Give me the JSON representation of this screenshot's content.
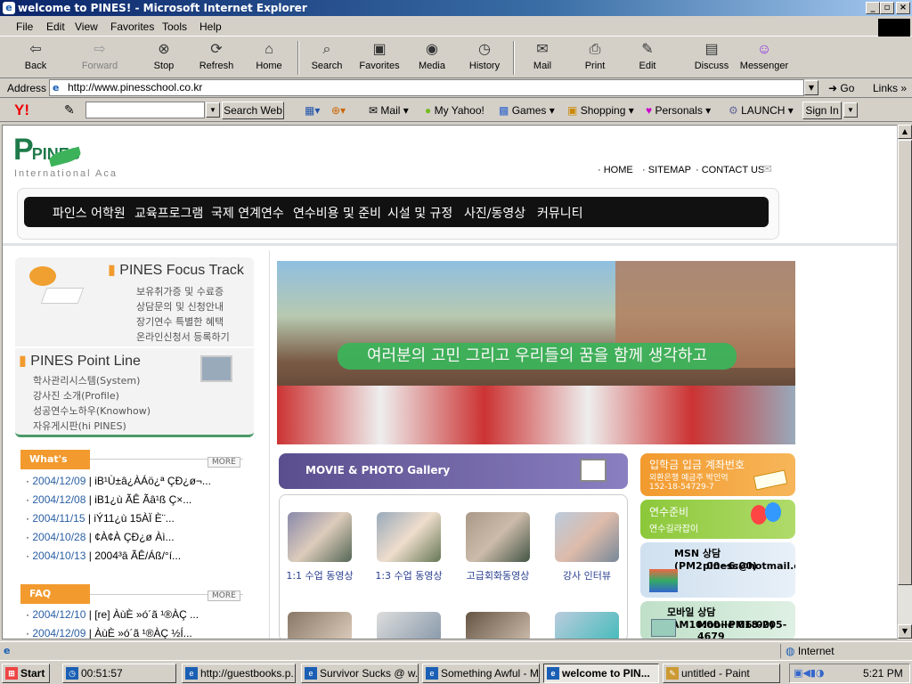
{
  "window": {
    "title": "welcome to PINES! - Microsoft Internet Explorer",
    "minimize": "_",
    "maximize": "▫",
    "close": "×"
  },
  "menu": [
    "File",
    "Edit",
    "View",
    "Favorites",
    "Tools",
    "Help"
  ],
  "toolbar": {
    "back": "Back",
    "forward": "Forward",
    "stop": "Stop",
    "refresh": "Refresh",
    "home": "Home",
    "search": "Search",
    "favorites": "Favorites",
    "media": "Media",
    "history": "History",
    "mail": "Mail",
    "print": "Print",
    "edit": "Edit",
    "discuss": "Discuss",
    "messenger": "Messenger"
  },
  "address": {
    "label": "Address",
    "url": "http://www.pinesschool.co.kr",
    "go": "Go",
    "links": "Links"
  },
  "yahoo": {
    "search_btn": "Search Web",
    "mail": "Mail",
    "myyahoo": "My Yahoo!",
    "games": "Games",
    "shopping": "Shopping",
    "personals": "Personals",
    "launch": "LAUNCH",
    "signin": "Sign In"
  },
  "page": {
    "logo_text": "PINES",
    "logo_sub": "International Aca",
    "top_links": [
      "HOME",
      "SITEMAP",
      "CONTACT US"
    ],
    "main_nav": [
      "파인스 어학원",
      "교육프로그램",
      "국제 연계연수",
      "연수비용 및 준비",
      "시설 및 규정",
      "사진/동영상",
      "커뮤니티"
    ],
    "focus_title": "PINES Focus Track",
    "focus_items": [
      "보유취가증 및 수료증",
      "상담문의 및 신청안내",
      "장기연수 특별한 혜택",
      "온라인신청서 등록하기"
    ],
    "point_title": "PINES Point Line",
    "point_items": [
      "학사관리시스템(System)",
      "강사진 소개(Profile)",
      "성공연수노하우(Knowhow)",
      "자유게시판(hi PINES)"
    ],
    "news_label": "What's News",
    "more": "MORE",
    "news": [
      {
        "date": "2004/12/09",
        "text": "iB¹Ù±â¿ÀÁö¿ª ÇÐ¿ø¬..."
      },
      {
        "date": "2004/12/08",
        "text": "iB1¿ù ÃÊ Ãâ¹ß Ç×..."
      },
      {
        "date": "2004/11/15",
        "text": "iÝ11¿ù 15ÀÏ È¨..."
      },
      {
        "date": "2004/10/28",
        "text": "¢À¢À ÇÐ¿ø Àì..."
      },
      {
        "date": "2004/10/13",
        "text": "2004³â ÃÊ/Áß/°í..."
      }
    ],
    "faq_label": "FAQ",
    "faq": [
      {
        "date": "2004/12/10",
        "text": "[re] ÀùÈ »ó´ã ¹®ÀÇ ..."
      },
      {
        "date": "2004/12/09",
        "text": "ÀùÈ »ó´ã ¹®ÀÇ ½Í..."
      }
    ],
    "hero_caption": "여러분의 고민 그리고 우리들의 꿈을 함께 생각하고",
    "gallery_title": "MOVIE & PHOTO Gallery",
    "gallery": [
      "1:1 수업 동영상",
      "1:3 수업 동영상",
      "고급회화동영상",
      "강사 인터뷰"
    ],
    "bank_title": "입학금 입금 계좌번호",
    "bank_line1": "외환은행 예금주 박인억",
    "bank_line2": "152-18-54729-7",
    "prep_title": "연수준비",
    "prep_sub": "연수길라잡이",
    "msn_title": "MSN 상담 (PM2:00~6:00)",
    "msn_email": "piness@hotmail.com",
    "mobile_title": "모바일 상담 (AM10:00~PM6:00)",
    "mobile_num": "Mobile 018-205-4679"
  },
  "status": {
    "zone": "Internet"
  },
  "taskbar": {
    "start": "Start",
    "tasks": [
      "00:51:57",
      "http://guestbooks.p...",
      "Survivor Sucks @ w...",
      "Something Awful - Mi...",
      "welcome to PIN...",
      "untitled - Paint"
    ],
    "clock": "5:21 PM"
  }
}
